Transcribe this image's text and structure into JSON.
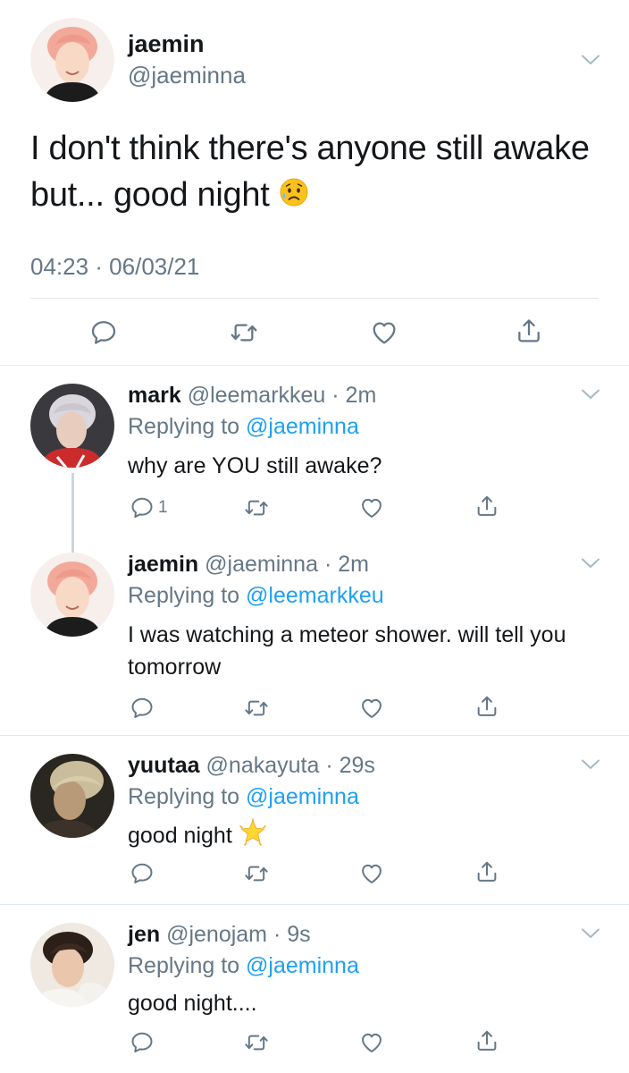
{
  "main_tweet": {
    "name": "jaemin",
    "handle": "@jaeminna",
    "text": "I don't think there's anyone still awake but... good night",
    "emoji": "sad-sweat-face-emoji",
    "timestamp": "04:23 · 06/03/21"
  },
  "replies": [
    {
      "name": "mark",
      "handle": "@leemarkkeu",
      "time": "· 2m",
      "replying_prefix": "Replying to ",
      "replying_to": "@jaeminna",
      "text": "why are YOU still awake?",
      "reply_count": "1"
    },
    {
      "name": "jaemin",
      "handle": "@jaeminna",
      "time": "· 2m",
      "replying_prefix": "Replying to ",
      "replying_to": "@leemarkkeu",
      "text": "I was watching a meteor shower. will tell you tomorrow",
      "reply_count": ""
    },
    {
      "name": "yuutaa",
      "handle": "@nakayuta",
      "time": "· 29s",
      "replying_prefix": "Replying to ",
      "replying_to": "@jaeminna",
      "text": "good night",
      "emoji": "glowing-star-emoji",
      "reply_count": ""
    },
    {
      "name": "jen",
      "handle": "@jenojam",
      "time": "· 9s",
      "replying_prefix": "Replying to ",
      "replying_to": "@jaeminna",
      "text": "good night....",
      "reply_count": ""
    }
  ],
  "colors": {
    "text": "#14171a",
    "secondary": "#657786",
    "link": "#1da1f2",
    "divider": "#e1e8ed",
    "icon": "#657786"
  }
}
